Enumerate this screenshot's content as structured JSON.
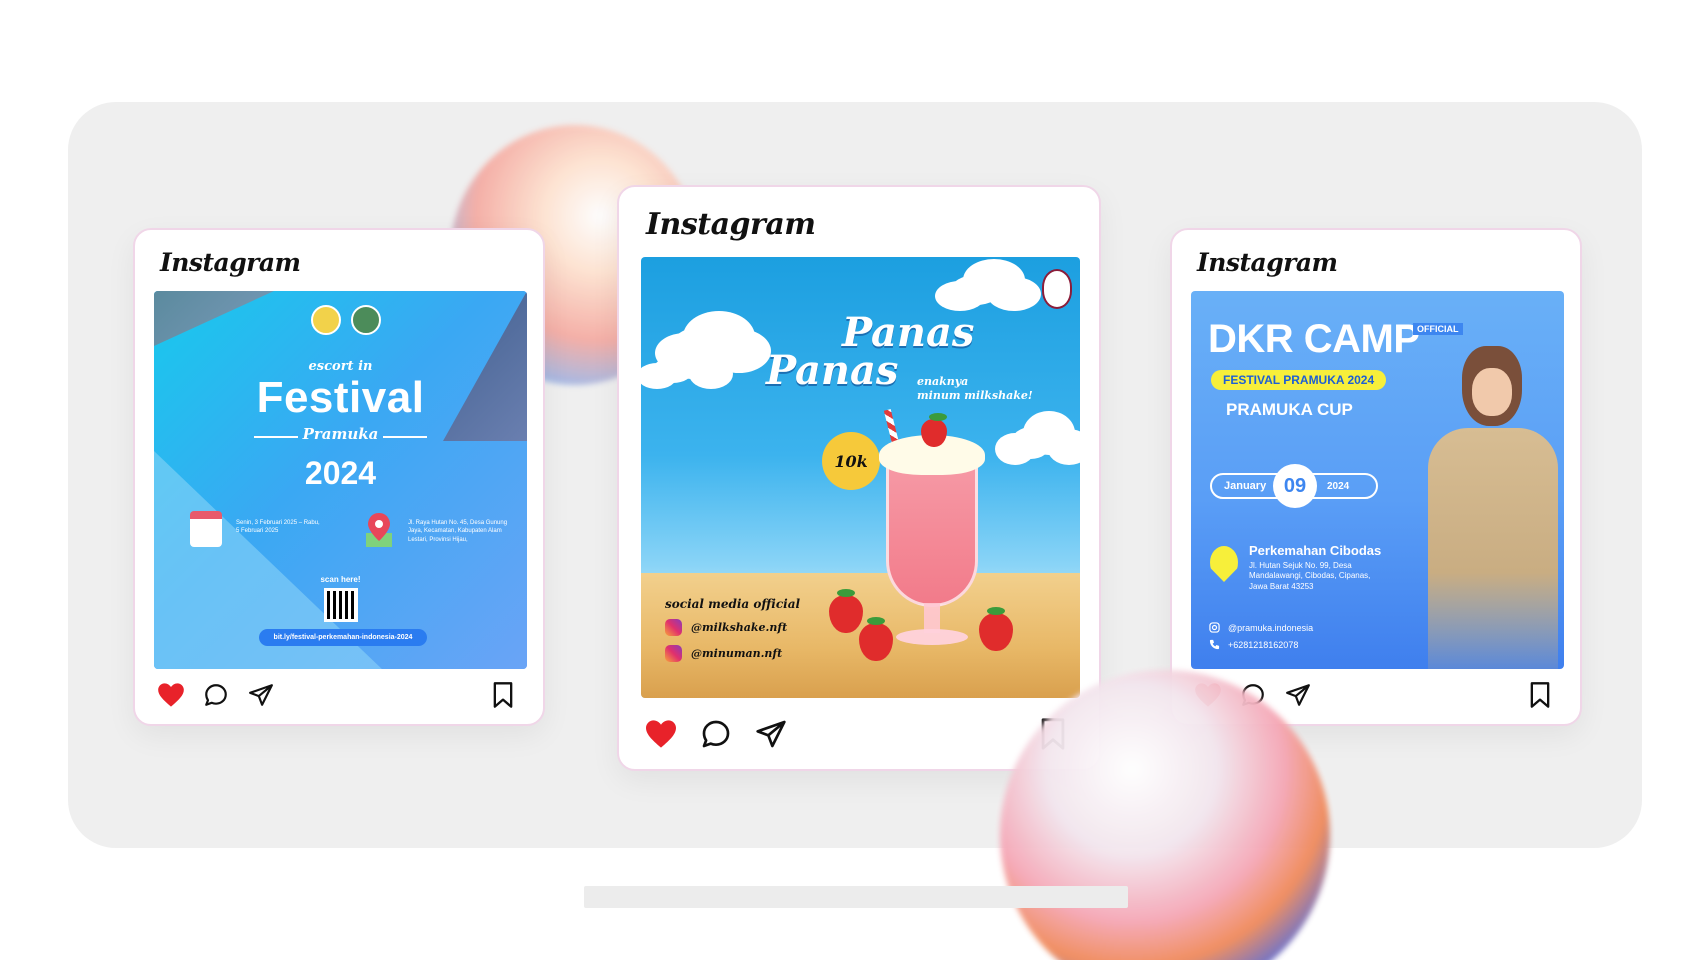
{
  "cards": [
    {
      "logo": "Instagram",
      "post": {
        "escort": "escort in",
        "title": "Festival",
        "subtitle": "Pramuka",
        "year": "2024",
        "date_text": "Senin, 3 Februari 2025 – Rabu, 5 Februari 2025",
        "location_text": "Jl. Raya Hutan No. 45, Desa Gunung Jaya, Kecamatan, Kabupaten Alam Lestari, Provinsi Hijau,",
        "scan": "scan here!",
        "url": "bit.ly/festival-perkemahan-indonesia-2024"
      },
      "actions": {
        "like": "heart-icon",
        "comment": "comment-icon",
        "share": "send-icon",
        "save": "bookmark-icon"
      }
    },
    {
      "logo": "Instagram",
      "post": {
        "title_line1": "Panas",
        "title_line2": "Panas",
        "tagline_line1": "enaknya",
        "tagline_line2": "minum milkshake!",
        "price": "10k",
        "social_heading": "social media official",
        "handles": [
          "@milkshake.nft",
          "@minuman.nft"
        ]
      },
      "actions": {
        "like": "heart-icon",
        "comment": "comment-icon",
        "share": "send-icon",
        "save": "bookmark-icon"
      }
    },
    {
      "logo": "Instagram",
      "post": {
        "title": "DKR CAMP",
        "official": "OFFICIAL",
        "festival": "FESTIVAL PRAMUKA 2024",
        "cup": "PRAMUKA CUP",
        "month": "January",
        "day": "09",
        "year": "2024",
        "place": "Perkemahan Cibodas",
        "address": "Jl. Hutan Sejuk No. 99, Desa Mandalawangi, Cibodas, Cipanas, Jawa Barat 43253",
        "instagram": "@pramuka.indonesia",
        "phone": "+6281218162078"
      },
      "actions": {
        "like": "heart-icon",
        "comment": "comment-icon",
        "share": "send-icon",
        "save": "bookmark-icon"
      }
    }
  ],
  "colors": {
    "panel": "#efefef",
    "like": "#e8222a",
    "card_border": "#f0d6e8",
    "accent_blue": "#3d86f0",
    "accent_yellow": "#f7ef3a"
  }
}
